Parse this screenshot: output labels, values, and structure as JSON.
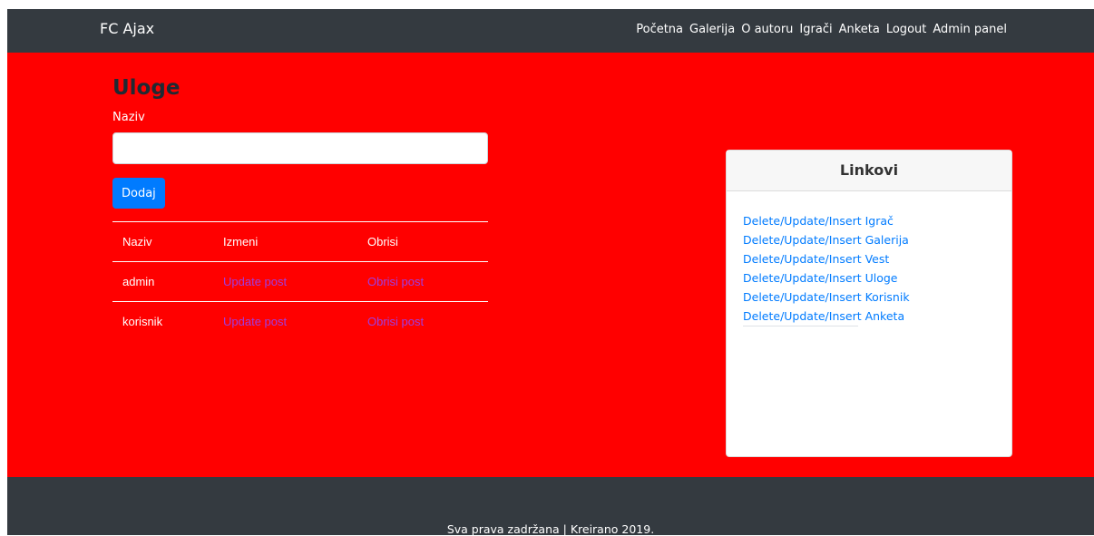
{
  "navbar": {
    "brand": "FC Ajax",
    "links": [
      "Početna",
      "Galerija",
      "O autoru",
      "Igrači",
      "Anketa",
      "Logout",
      "Admin panel"
    ]
  },
  "main": {
    "title": "Uloge",
    "field_label": "Naziv",
    "input_value": "",
    "add_button": "Dodaj",
    "table": {
      "headers": [
        "Naziv",
        "Izmeni",
        "Obrisi"
      ],
      "rows": [
        {
          "naziv": "admin",
          "update": "Update post",
          "delete": "Obrisi post"
        },
        {
          "naziv": "korisnik",
          "update": "Update post",
          "delete": "Obrisi post"
        }
      ]
    }
  },
  "links_card": {
    "title": "Linkovi",
    "links": [
      "Delete/Update/Insert Igrač",
      "Delete/Update/Insert Galerija",
      "Delete/Update/Insert Vest",
      "Delete/Update/Insert Uloge",
      "Delete/Update/Insert Korisnik",
      "Delete/Update/Insert Anketa"
    ]
  },
  "footer": {
    "text": "Sva prava zadržana | Kreirano 2019."
  },
  "colors": {
    "navbar": "#343a40",
    "main_background": "#ff0000",
    "primary": "#007bff",
    "table_link": "#a03ce0"
  }
}
